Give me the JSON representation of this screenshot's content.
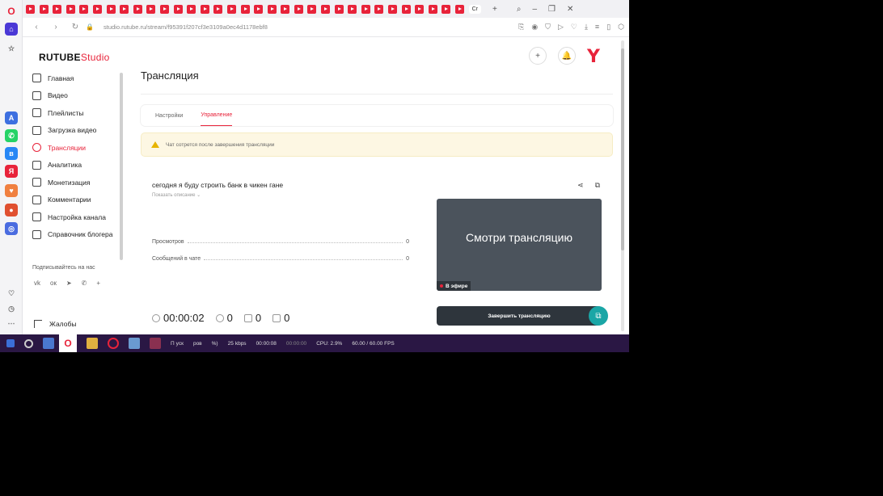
{
  "browser": {
    "url": "studio.rutube.ru/stream/f95391f207cf3e3109a0ec4d1178ebf8",
    "active_tab_label": "Cr"
  },
  "header": {
    "logo_main": "RUTUBE",
    "logo_sub": "Studio"
  },
  "sidebar": {
    "items": [
      {
        "label": "Главная",
        "icon": "home-icon"
      },
      {
        "label": "Видео",
        "icon": "video-icon"
      },
      {
        "label": "Плейлисты",
        "icon": "playlist-icon"
      },
      {
        "label": "Загрузка видео",
        "icon": "upload-icon"
      },
      {
        "label": "Трансляции",
        "icon": "broadcast-icon",
        "active": true
      },
      {
        "label": "Аналитика",
        "icon": "analytics-icon"
      },
      {
        "label": "Монетизация",
        "icon": "monetization-icon"
      },
      {
        "label": "Комментарии",
        "icon": "comments-icon"
      },
      {
        "label": "Настройка канала",
        "icon": "settings-icon"
      },
      {
        "label": "Справочник блогера",
        "icon": "help-icon"
      }
    ],
    "follow_label": "Подписывайтесь на нас",
    "complaints_label": "Жалобы"
  },
  "main": {
    "page_title": "Трансляция",
    "tabs": [
      {
        "label": "Настройки",
        "active": false
      },
      {
        "label": "Управление",
        "active": true
      }
    ],
    "warning_text": "Чат сотрется после завершения трансляции",
    "stream_title": "сегодня я буду строить банк в чикен гане",
    "show_description": "Показать описание",
    "stats": [
      {
        "label": "Просмотров",
        "value": "0"
      },
      {
        "label": "Сообщений в чате",
        "value": "0"
      }
    ],
    "player_text": "Смотри трансляцию",
    "live_badge": "В эфире",
    "duration": "00:00:02",
    "viewers": "0",
    "likes": "0",
    "dislikes": "0",
    "end_button": "Завершить трансляцию"
  },
  "taskbar": {
    "items": [
      "П",
      "уск",
      "ров",
      "%)",
      "25",
      "kbps",
      "00:00:08",
      "00:00:00",
      "CPU: 2.9%",
      "60.00 / 60.00 FPS"
    ]
  },
  "colors": {
    "accent": "#e8233a",
    "teal": "#1aa6a6",
    "dark_button": "#2e353c",
    "warning_bg": "#fdf7e3"
  }
}
